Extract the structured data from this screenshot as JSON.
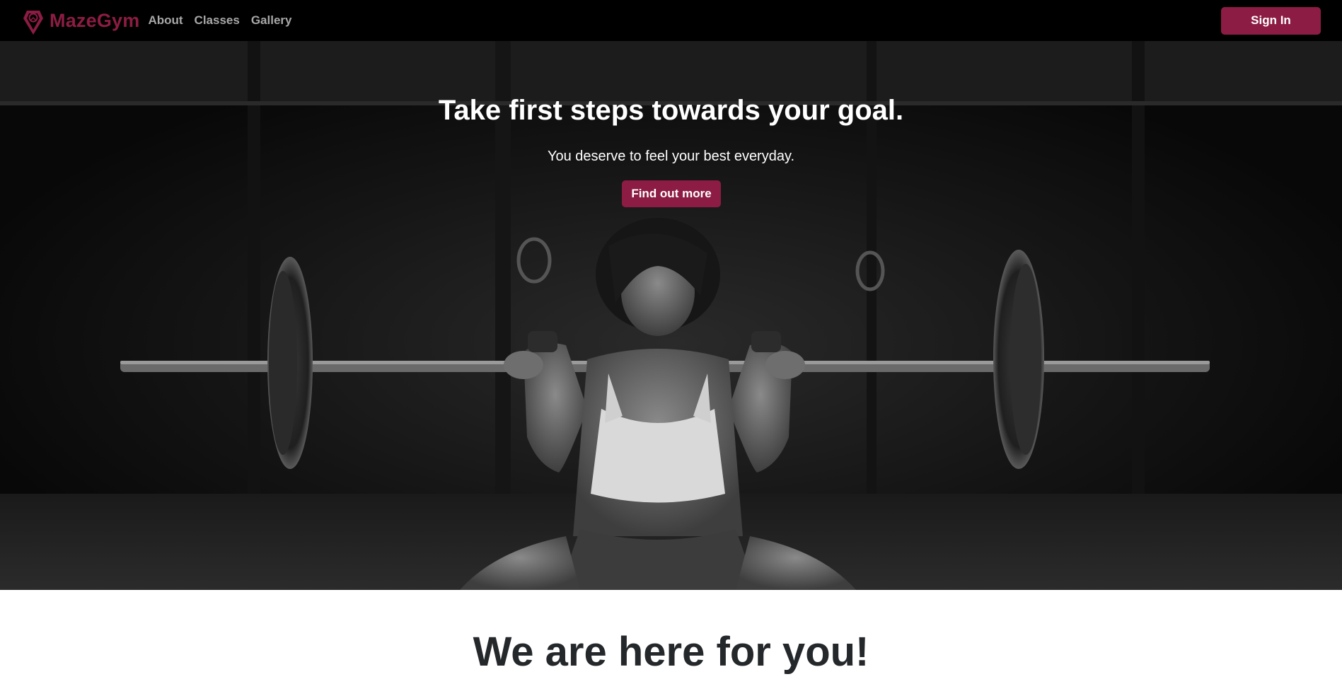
{
  "brand": {
    "name": "MazeGym",
    "logo_icon": "map-pin-gem-icon",
    "color": "#8c1c43"
  },
  "nav": {
    "links": [
      {
        "label": "About"
      },
      {
        "label": "Classes"
      },
      {
        "label": "Gallery"
      }
    ],
    "signin_label": "Sign In"
  },
  "hero": {
    "title": "Take first steps towards your goal.",
    "subtitle": "You deserve to feel your best everyday.",
    "cta_label": "Find out more",
    "image": "black-and-white photo of woman holding barbell in front squat position in gym"
  },
  "section": {
    "heading": "We are here for you!"
  },
  "colors": {
    "accent": "#8c1c43",
    "navbar_bg": "#000000",
    "nav_link": "#a8a8a8",
    "heading_text": "#25282b"
  }
}
